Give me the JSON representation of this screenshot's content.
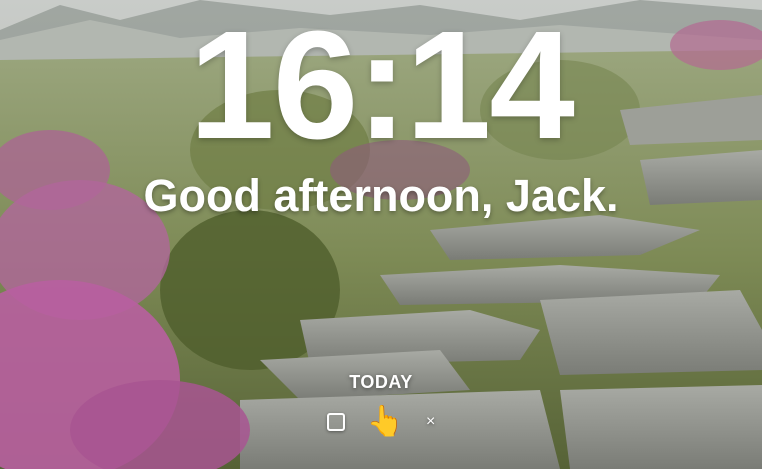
{
  "clock": {
    "time": "16:14"
  },
  "greeting": {
    "text": "Good afternoon, Jack."
  },
  "today": {
    "title": "TODAY",
    "focus_text": "👆",
    "delete_label": "×",
    "checked": false
  }
}
